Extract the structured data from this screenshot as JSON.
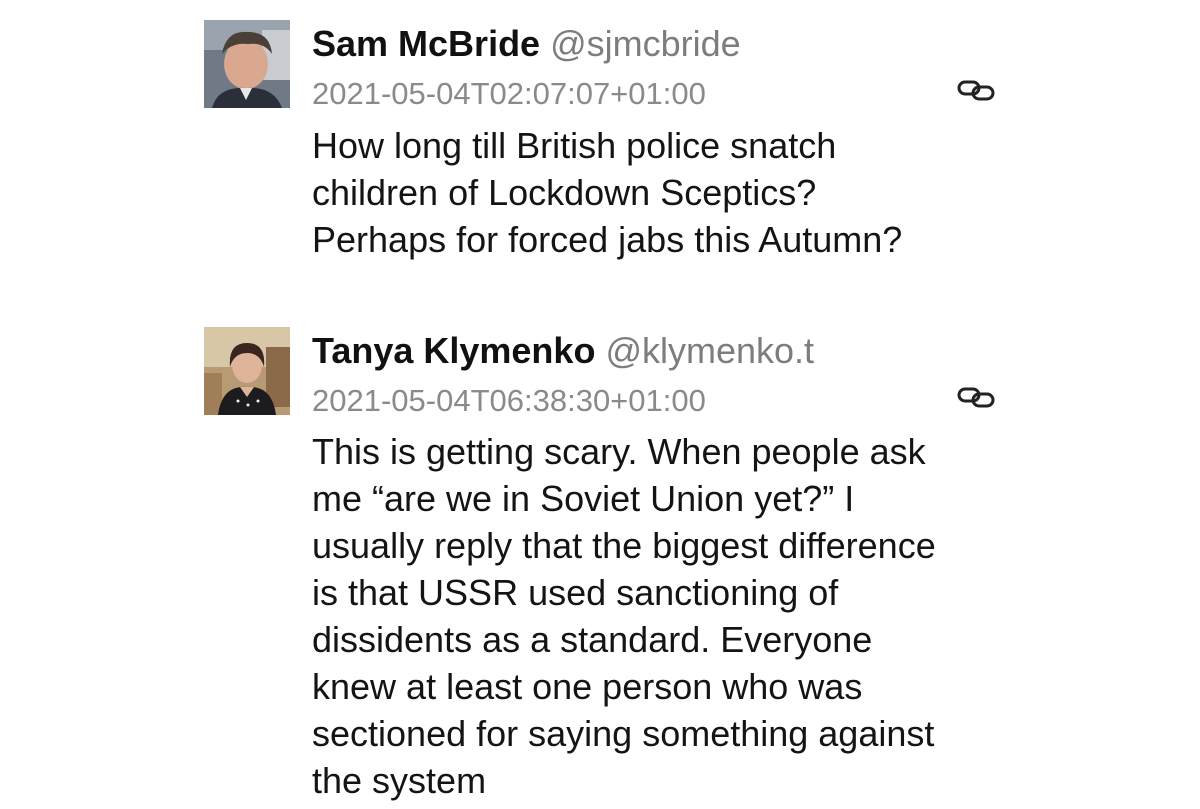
{
  "posts": [
    {
      "author_name": "Sam McBride",
      "handle": "@sjmcbride",
      "timestamp": "2021-05-04T02:07:07+01:00",
      "link_icon": "link-icon",
      "text_lines": [
        "How long till British police snatch",
        "children of Lockdown Sceptics?",
        "Perhaps for forced jabs this Autumn?"
      ]
    },
    {
      "author_name": "Tanya Klymenko",
      "handle": "@klymenko.t",
      "timestamp": "2021-05-04T06:38:30+01:00",
      "link_icon": "link-icon",
      "text_lines": [
        "This is getting scary. When people ask",
        "me “are we in Soviet Union yet?” I",
        "usually reply that the biggest difference",
        "is that USSR used sanctioning of",
        "dissidents as a standard. Everyone",
        "knew at least one person who was",
        "sectioned for saying something against",
        "the system"
      ]
    }
  ],
  "colors": {
    "name": "#111111",
    "handle": "#7d7d7d",
    "timestamp": "#8a8a8a",
    "body": "#141414",
    "background": "#ffffff"
  }
}
